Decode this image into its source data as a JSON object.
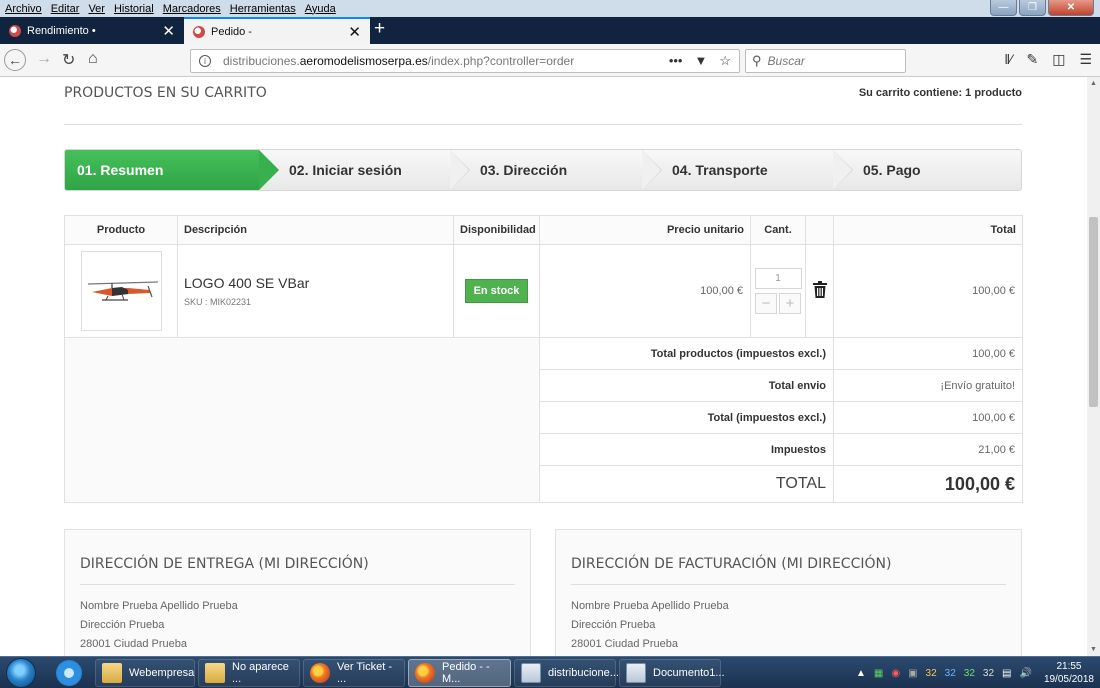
{
  "menu": [
    "Archivo",
    "Editar",
    "Ver",
    "Historial",
    "Marcadores",
    "Herramientas",
    "Ayuda"
  ],
  "tabs": [
    {
      "title": "Rendimiento •",
      "active": false
    },
    {
      "title": "Pedido -",
      "active": true
    }
  ],
  "url": {
    "prefix": "distribuciones.",
    "domain": "aeromodelismoserpa.es",
    "path": "/index.php?controller=order"
  },
  "search": {
    "placeholder": "Buscar"
  },
  "page": {
    "title": "PRODUCTOS EN SU CARRITO",
    "cart_summary": "Su carrito contiene: 1 producto",
    "steps": [
      "01. Resumen",
      "02. Iniciar sesión",
      "03. Dirección",
      "04. Transporte",
      "05. Pago"
    ],
    "columns": [
      "Producto",
      "Descripción",
      "Disponibilidad",
      "Precio unitario",
      "Cant.",
      "Total"
    ],
    "product": {
      "name": "LOGO 400 SE VBar",
      "sku": "SKU : MIK02231",
      "availability": "En stock",
      "unit_price": "100,00 €",
      "quantity": "1",
      "total": "100,00 €"
    },
    "summary": [
      {
        "label": "Total productos (impuestos excl.)",
        "value": "100,00 €"
      },
      {
        "label": "Total envio",
        "value": "¡Envío gratuito!"
      },
      {
        "label": "Total (impuestos excl.)",
        "value": "100,00 €"
      },
      {
        "label": "Impuestos",
        "value": "21,00 €"
      }
    ],
    "grand_total": {
      "label": "TOTAL",
      "value": "100,00 €"
    },
    "delivery": {
      "title": "DIRECCIÓN DE ENTREGA (MI DIRECCIÓN)",
      "lines": [
        "Nombre Prueba Apellido Prueba",
        "Dirección Prueba",
        "28001 Ciudad Prueba"
      ]
    },
    "billing": {
      "title": "DIRECCIÓN DE FACTURACIÓN (MI DIRECCIÓN)",
      "lines": [
        "Nombre Prueba Apellido Prueba",
        "Dirección Prueba",
        "28001 Ciudad Prueba"
      ]
    }
  },
  "taskbar": {
    "items": [
      "Webempresa",
      "No aparece ...",
      "Ver Ticket - ...",
      "Pedido - - M...",
      "distribucione...",
      "Documento1..."
    ],
    "tray_numbers": [
      "32",
      "32",
      "32",
      "32"
    ],
    "time": "21:55",
    "date": "19/05/2018"
  },
  "colors": {
    "step_active": "#2fa447",
    "badge": "#4fb24f",
    "tab_accent": "#0a84ff"
  }
}
